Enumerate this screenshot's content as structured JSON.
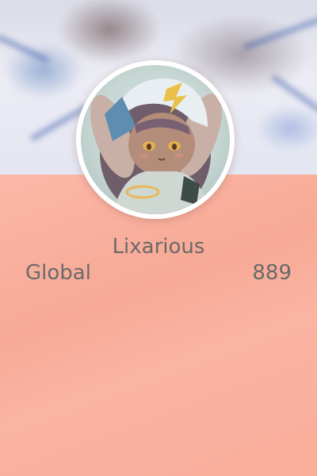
{
  "profile": {
    "username": "Lixarious",
    "rank_label": "Global",
    "rank_value": "889"
  },
  "colors": {
    "background": "#f7a995",
    "text": "#6a6a6a",
    "avatar_border": "#ffffff"
  }
}
